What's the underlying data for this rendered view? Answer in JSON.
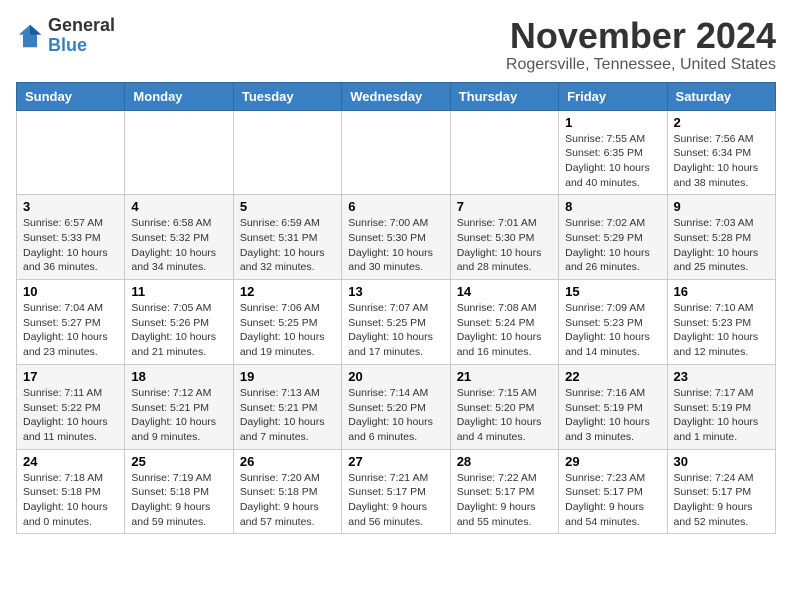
{
  "logo": {
    "general": "General",
    "blue": "Blue"
  },
  "title": "November 2024",
  "subtitle": "Rogersville, Tennessee, United States",
  "days_header": [
    "Sunday",
    "Monday",
    "Tuesday",
    "Wednesday",
    "Thursday",
    "Friday",
    "Saturday"
  ],
  "weeks": [
    [
      {
        "day": "",
        "info": ""
      },
      {
        "day": "",
        "info": ""
      },
      {
        "day": "",
        "info": ""
      },
      {
        "day": "",
        "info": ""
      },
      {
        "day": "",
        "info": ""
      },
      {
        "day": "1",
        "info": "Sunrise: 7:55 AM\nSunset: 6:35 PM\nDaylight: 10 hours and 40 minutes."
      },
      {
        "day": "2",
        "info": "Sunrise: 7:56 AM\nSunset: 6:34 PM\nDaylight: 10 hours and 38 minutes."
      }
    ],
    [
      {
        "day": "3",
        "info": "Sunrise: 6:57 AM\nSunset: 5:33 PM\nDaylight: 10 hours and 36 minutes."
      },
      {
        "day": "4",
        "info": "Sunrise: 6:58 AM\nSunset: 5:32 PM\nDaylight: 10 hours and 34 minutes."
      },
      {
        "day": "5",
        "info": "Sunrise: 6:59 AM\nSunset: 5:31 PM\nDaylight: 10 hours and 32 minutes."
      },
      {
        "day": "6",
        "info": "Sunrise: 7:00 AM\nSunset: 5:30 PM\nDaylight: 10 hours and 30 minutes."
      },
      {
        "day": "7",
        "info": "Sunrise: 7:01 AM\nSunset: 5:30 PM\nDaylight: 10 hours and 28 minutes."
      },
      {
        "day": "8",
        "info": "Sunrise: 7:02 AM\nSunset: 5:29 PM\nDaylight: 10 hours and 26 minutes."
      },
      {
        "day": "9",
        "info": "Sunrise: 7:03 AM\nSunset: 5:28 PM\nDaylight: 10 hours and 25 minutes."
      }
    ],
    [
      {
        "day": "10",
        "info": "Sunrise: 7:04 AM\nSunset: 5:27 PM\nDaylight: 10 hours and 23 minutes."
      },
      {
        "day": "11",
        "info": "Sunrise: 7:05 AM\nSunset: 5:26 PM\nDaylight: 10 hours and 21 minutes."
      },
      {
        "day": "12",
        "info": "Sunrise: 7:06 AM\nSunset: 5:25 PM\nDaylight: 10 hours and 19 minutes."
      },
      {
        "day": "13",
        "info": "Sunrise: 7:07 AM\nSunset: 5:25 PM\nDaylight: 10 hours and 17 minutes."
      },
      {
        "day": "14",
        "info": "Sunrise: 7:08 AM\nSunset: 5:24 PM\nDaylight: 10 hours and 16 minutes."
      },
      {
        "day": "15",
        "info": "Sunrise: 7:09 AM\nSunset: 5:23 PM\nDaylight: 10 hours and 14 minutes."
      },
      {
        "day": "16",
        "info": "Sunrise: 7:10 AM\nSunset: 5:23 PM\nDaylight: 10 hours and 12 minutes."
      }
    ],
    [
      {
        "day": "17",
        "info": "Sunrise: 7:11 AM\nSunset: 5:22 PM\nDaylight: 10 hours and 11 minutes."
      },
      {
        "day": "18",
        "info": "Sunrise: 7:12 AM\nSunset: 5:21 PM\nDaylight: 10 hours and 9 minutes."
      },
      {
        "day": "19",
        "info": "Sunrise: 7:13 AM\nSunset: 5:21 PM\nDaylight: 10 hours and 7 minutes."
      },
      {
        "day": "20",
        "info": "Sunrise: 7:14 AM\nSunset: 5:20 PM\nDaylight: 10 hours and 6 minutes."
      },
      {
        "day": "21",
        "info": "Sunrise: 7:15 AM\nSunset: 5:20 PM\nDaylight: 10 hours and 4 minutes."
      },
      {
        "day": "22",
        "info": "Sunrise: 7:16 AM\nSunset: 5:19 PM\nDaylight: 10 hours and 3 minutes."
      },
      {
        "day": "23",
        "info": "Sunrise: 7:17 AM\nSunset: 5:19 PM\nDaylight: 10 hours and 1 minute."
      }
    ],
    [
      {
        "day": "24",
        "info": "Sunrise: 7:18 AM\nSunset: 5:18 PM\nDaylight: 10 hours and 0 minutes."
      },
      {
        "day": "25",
        "info": "Sunrise: 7:19 AM\nSunset: 5:18 PM\nDaylight: 9 hours and 59 minutes."
      },
      {
        "day": "26",
        "info": "Sunrise: 7:20 AM\nSunset: 5:18 PM\nDaylight: 9 hours and 57 minutes."
      },
      {
        "day": "27",
        "info": "Sunrise: 7:21 AM\nSunset: 5:17 PM\nDaylight: 9 hours and 56 minutes."
      },
      {
        "day": "28",
        "info": "Sunrise: 7:22 AM\nSunset: 5:17 PM\nDaylight: 9 hours and 55 minutes."
      },
      {
        "day": "29",
        "info": "Sunrise: 7:23 AM\nSunset: 5:17 PM\nDaylight: 9 hours and 54 minutes."
      },
      {
        "day": "30",
        "info": "Sunrise: 7:24 AM\nSunset: 5:17 PM\nDaylight: 9 hours and 52 minutes."
      }
    ]
  ]
}
